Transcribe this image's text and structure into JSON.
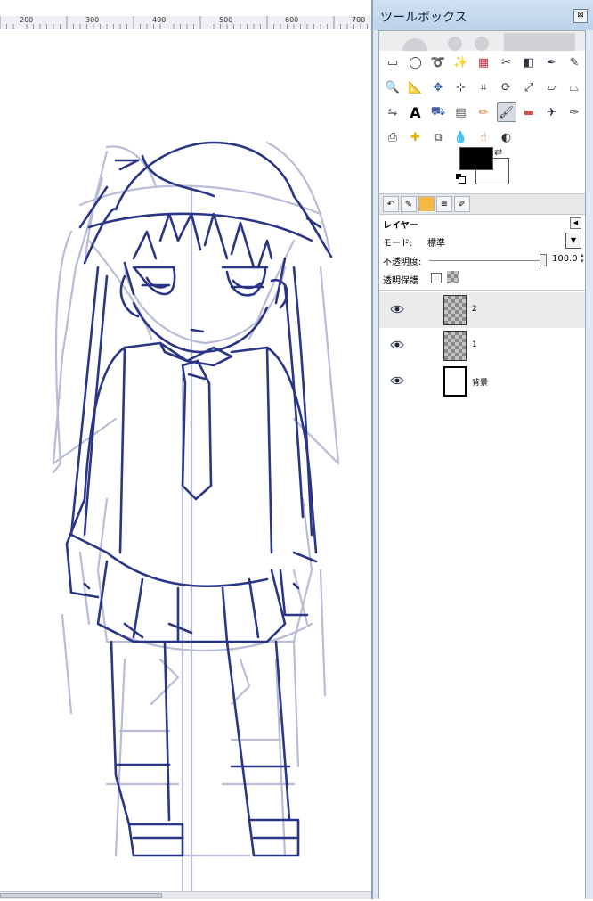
{
  "canvas": {
    "ruler_labels": [
      "200",
      "300",
      "400",
      "500",
      "600",
      "700"
    ]
  },
  "toolbox": {
    "title": "ツールボックス",
    "close_label": "⊠",
    "tools": [
      "rect-select-icon",
      "ellipse-select-icon",
      "free-select-icon",
      "fuzzy-select-icon",
      "color-select-icon",
      "scissors-icon",
      "foreground-select-icon",
      "paths-icon",
      "color-picker-icon",
      "zoom-icon",
      "measure-icon",
      "move-icon",
      "align-icon",
      "crop-icon",
      "rotate-icon",
      "scale-icon",
      "shear-icon",
      "perspective-icon",
      "flip-icon",
      "text-icon",
      "bucket-fill-icon",
      "blend-icon",
      "pencil-icon",
      "paintbrush-icon",
      "eraser-icon",
      "airbrush-icon",
      "ink-icon",
      "clone-icon",
      "heal-icon",
      "perspective-clone-icon",
      "blur-icon",
      "smudge-icon",
      "dodge-burn-icon"
    ],
    "active_tool": "paintbrush-icon",
    "fg_color": "#000000",
    "bg_color": "#ffffff"
  },
  "layers": {
    "title": "レイヤー",
    "mode_label": "モード:",
    "mode_value": "標準",
    "opacity_label": "不透明度:",
    "opacity_value": "100.0",
    "opacity_fraction": 1.0,
    "lock_label": "透明保護",
    "items": [
      {
        "name": "2",
        "thumb": "checker",
        "selected": true
      },
      {
        "name": "1",
        "thumb": "checker",
        "selected": false
      },
      {
        "name": "背景",
        "thumb": "white",
        "selected": false
      }
    ]
  }
}
